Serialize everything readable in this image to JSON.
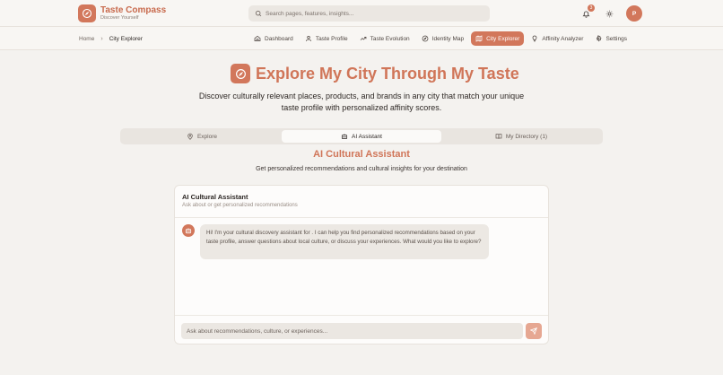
{
  "header": {
    "brand_title": "Taste Compass",
    "brand_subtitle": "Discover Yourself",
    "search_placeholder": "Search pages, features, insights...",
    "notification_count": "3",
    "avatar_initial": "P"
  },
  "breadcrumb": {
    "home": "Home",
    "current": "City Explorer"
  },
  "nav": {
    "items": [
      {
        "label": "Dashboard",
        "icon": "home-icon"
      },
      {
        "label": "Taste Profile",
        "icon": "user-icon"
      },
      {
        "label": "Taste Evolution",
        "icon": "trending-up-icon"
      },
      {
        "label": "Identity Map",
        "icon": "compass-icon"
      },
      {
        "label": "City Explorer",
        "icon": "map-icon",
        "active": true
      },
      {
        "label": "Affinity Analyzer",
        "icon": "lightbulb-icon"
      },
      {
        "label": "Settings",
        "icon": "gear-icon"
      }
    ]
  },
  "hero": {
    "title": "Explore My City Through My Taste",
    "description": "Discover culturally relevant places, products, and brands in any city that match your unique taste profile with personalized affinity scores."
  },
  "tabs": [
    {
      "label": "Explore",
      "icon": "map-pin-icon"
    },
    {
      "label": "AI Assistant",
      "icon": "bot-icon",
      "active": true
    },
    {
      "label": "My Directory (1)",
      "icon": "book-icon"
    }
  ],
  "assistant": {
    "section_title": "AI Cultural Assistant",
    "section_subtitle": "Get personalized recommendations and cultural insights for your destination",
    "card_title": "AI Cultural Assistant",
    "card_subtitle": "Ask about or get personalized recommendations",
    "message": "Hi! I'm your cultural discovery assistant for . I can help you find personalized recommendations based on your taste profile, answer questions about local culture, or discuss your experiences. What would you like to explore?",
    "input_placeholder": "Ask about recommendations, culture, or experiences..."
  },
  "colors": {
    "accent": "#d2775b",
    "accent_light": "#e6a792",
    "background": "#f4f2ef"
  }
}
